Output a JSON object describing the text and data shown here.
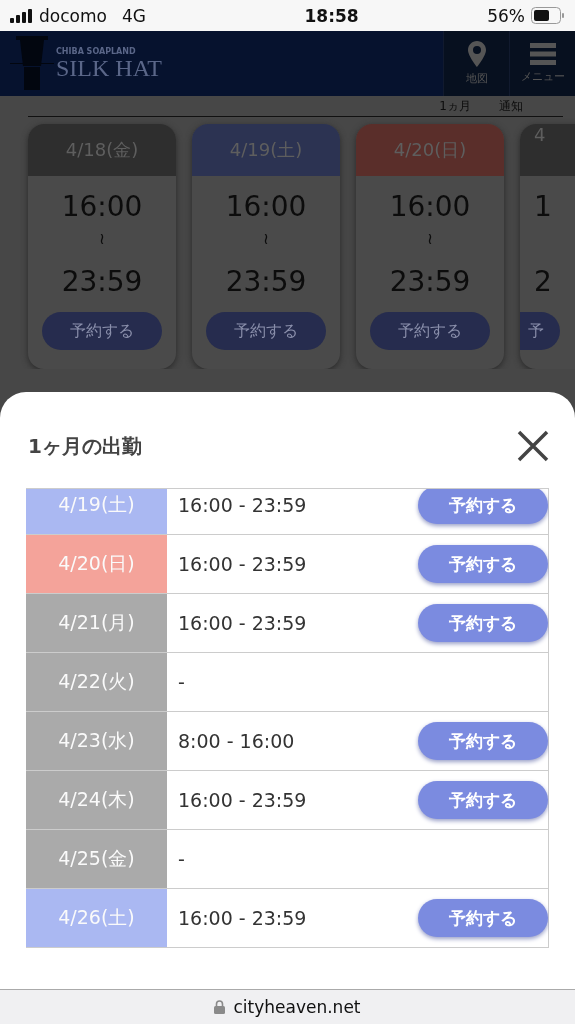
{
  "status_bar": {
    "carrier": "docomo",
    "network": "4G",
    "time": "18:58",
    "battery": "56%"
  },
  "header": {
    "logo_small": "CHIBA SOAPLAND",
    "logo": "SILK HAT",
    "buttons": [
      {
        "kind": "map",
        "label": "地図"
      },
      {
        "kind": "menu",
        "label": "メニュー"
      }
    ]
  },
  "tabs": [
    {
      "label": "1ヵ月"
    },
    {
      "label": "通知"
    }
  ],
  "cards": [
    {
      "date": "4/18(金)",
      "start": "16:00",
      "sep": "≀",
      "end": "23:59",
      "button": "予約する",
      "color": "#2e2e2e"
    },
    {
      "date": "4/19(土)",
      "start": "16:00",
      "sep": "≀",
      "end": "23:59",
      "button": "予約する",
      "color": "#2c3352"
    },
    {
      "date": "4/20(日)",
      "start": "16:00",
      "sep": "≀",
      "end": "23:59",
      "button": "予約する",
      "color": "#5a2e2a"
    },
    {
      "date": "4",
      "start": "1",
      "end": "2",
      "button": "予",
      "color": "#2e2e2e"
    }
  ],
  "modal": {
    "title": "1ヶ月の出勤",
    "rows": [
      {
        "date": "4/19(土)",
        "time": "16:00 - 23:59",
        "button": "予約する",
        "color": "#aab8f2"
      },
      {
        "date": "4/20(日)",
        "time": "16:00 - 23:59",
        "button": "予約する",
        "color": "#f4a39a"
      },
      {
        "date": "4/21(月)",
        "time": "16:00 - 23:59",
        "button": "予約する",
        "color": "#aaaaaa"
      },
      {
        "date": "4/22(火)",
        "time": "-",
        "color": "#aaaaaa"
      },
      {
        "date": "4/23(水)",
        "time": "8:00 - 16:00",
        "button": "予約する",
        "color": "#aaaaaa"
      },
      {
        "date": "4/24(木)",
        "time": "16:00 - 23:59",
        "button": "予約する",
        "color": "#aaaaaa"
      },
      {
        "date": "4/25(金)",
        "time": "-",
        "color": "#aaaaaa"
      },
      {
        "date": "4/26(土)",
        "time": "16:00 - 23:59",
        "button": "予約する",
        "color": "#aab8f2"
      }
    ]
  },
  "address_bar": {
    "url": "cityheaven.net"
  }
}
